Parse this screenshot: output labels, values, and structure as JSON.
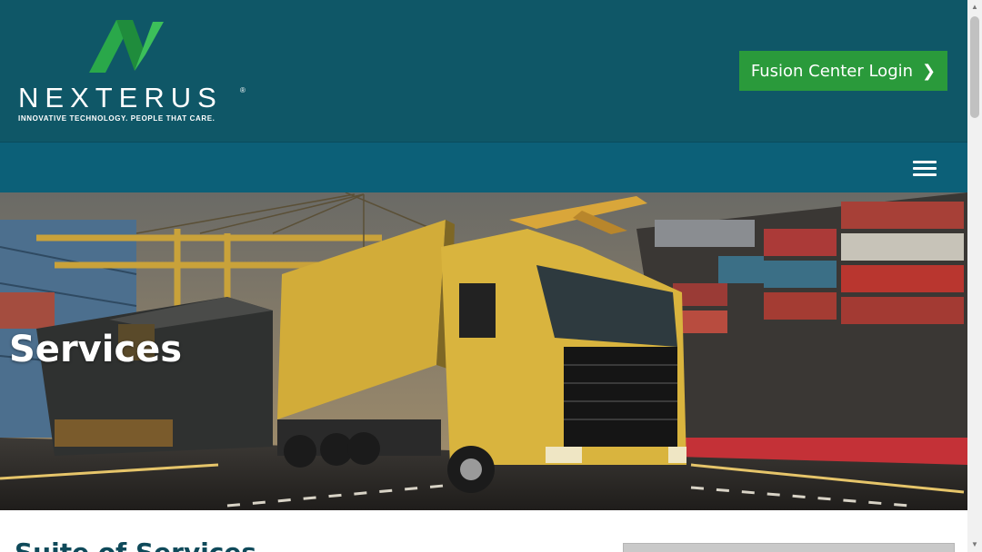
{
  "header": {
    "logo": {
      "wordmark": "NEXTERUS",
      "registered": "®",
      "tagline": "INNOVATIVE TECHNOLOGY. PEOPLE THAT CARE."
    },
    "login_button": {
      "label": "Fusion Center Login",
      "icon": "chevron-right-icon"
    }
  },
  "nav": {
    "menu_icon": "hamburger-menu-icon"
  },
  "hero": {
    "title": "Services",
    "image": "truck-train-ship-cargo-photo"
  },
  "main": {
    "section_title": "Suite of Services"
  },
  "colors": {
    "header_bg": "#0f5767",
    "nav_bg": "#0c6078",
    "button_green": "#2a9a3b",
    "logo_green": "#2aa84a",
    "heading_teal": "#0f4a5a"
  }
}
